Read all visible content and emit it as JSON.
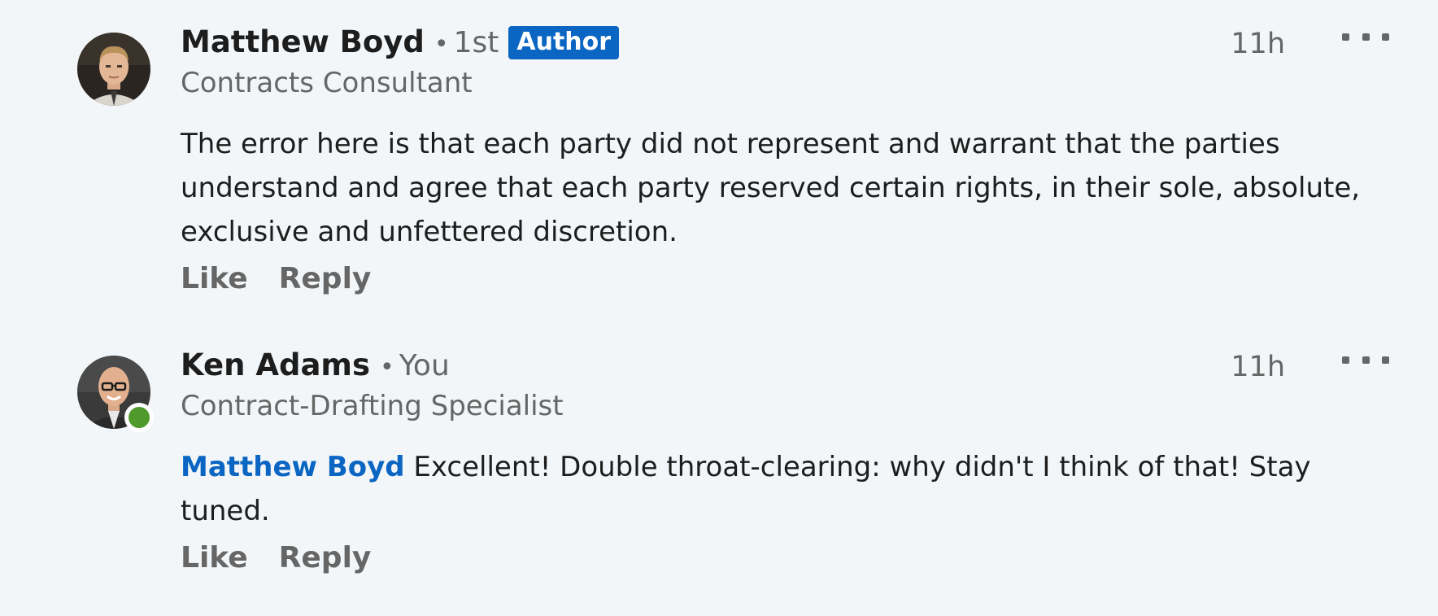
{
  "comments": [
    {
      "author": "Matthew Boyd",
      "separator": "•",
      "degree": "1st",
      "badge": "Author",
      "headline": "Contracts Consultant",
      "time": "11h",
      "mention": "",
      "text": "The error here is that each party did not represent and warrant that the parties understand and agree that each party reserved certain rights, in their sole, absolute, exclusive and unfettered discretion.",
      "like_label": "Like",
      "reply_label": "Reply",
      "avatar_icon": "profile-photo-man-blond",
      "online": false
    },
    {
      "author": "Ken Adams",
      "separator": "•",
      "degree": "You",
      "badge": "",
      "headline": "Contract-Drafting Specialist",
      "time": "11h",
      "mention": "Matthew Boyd",
      "text": "Excellent! Double throat-clearing: why didn't I think of that! Stay tuned.",
      "like_label": "Like",
      "reply_label": "Reply",
      "avatar_icon": "profile-photo-man-glasses",
      "online": true
    }
  ],
  "colors": {
    "background": "#f3f6f8",
    "accent": "#0a66c2",
    "online": "#4f9a2a",
    "secondary_text": "#666666"
  }
}
